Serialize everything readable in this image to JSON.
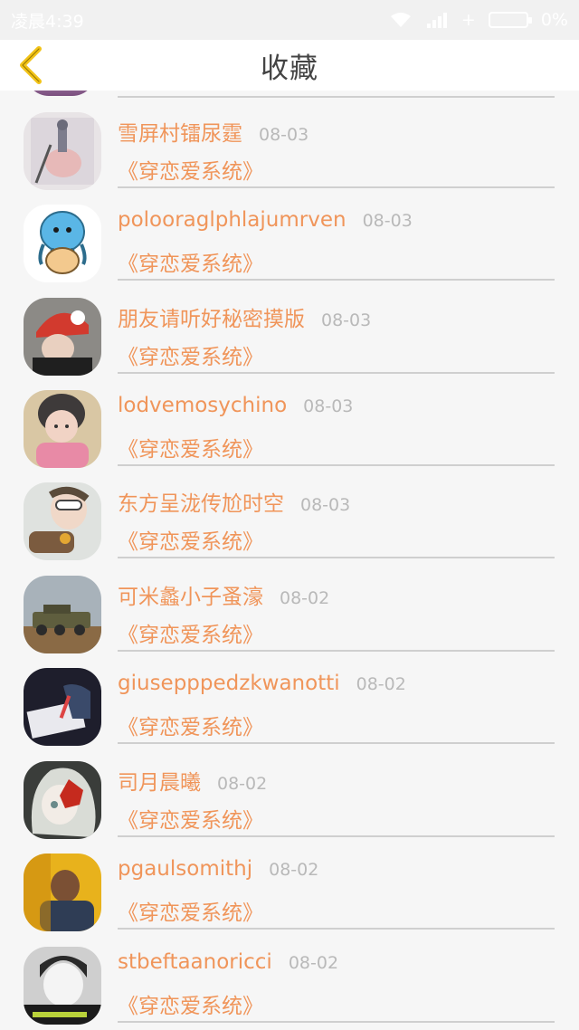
{
  "status_bar": {
    "carrier_time": "凌晨4:39",
    "battery": "0%"
  },
  "header": {
    "title": "收藏",
    "back_icon": "chevron-left-icon",
    "back_color": "#f2c318"
  },
  "colors": {
    "accent": "#f0955a",
    "date": "#b9b9b9"
  },
  "items": [
    {
      "name": "雪屏村镭尿霆",
      "date": "08-03",
      "book": "《穿恋爱系统》",
      "avatar": "avatar-illustration"
    },
    {
      "name": "polooraglphlajumrven",
      "date": "08-03",
      "book": "《穿恋爱系统》",
      "avatar": "avatar-octopus-cartoon"
    },
    {
      "name": "朋友请听好秘密摸版",
      "date": "08-03",
      "book": "《穿恋爱系统》",
      "avatar": "avatar-red-helmet"
    },
    {
      "name": "lodvemosychino",
      "date": "08-03",
      "book": "《穿恋爱系统》",
      "avatar": "avatar-child"
    },
    {
      "name": "东方呈泷传尬时空",
      "date": "08-03",
      "book": "《穿恋爱系统》",
      "avatar": "avatar-glasses"
    },
    {
      "name": "可米蠡小子蚤濠",
      "date": "08-02",
      "book": "《穿恋爱系统》",
      "avatar": "avatar-vehicle"
    },
    {
      "name": "giusepppedzkwanotti",
      "date": "08-02",
      "book": "《穿恋爱系统》",
      "avatar": "avatar-writing"
    },
    {
      "name": "司月晨曦",
      "date": "08-02",
      "book": "《穿恋爱系统》",
      "avatar": "avatar-anime-girl"
    },
    {
      "name": "pgaulsomithj",
      "date": "08-02",
      "book": "《穿恋爱系统》",
      "avatar": "avatar-yellow-photo"
    },
    {
      "name": "stbeftaanoricci",
      "date": "08-02",
      "book": "《穿恋爱系统》",
      "avatar": "avatar-grayscale"
    }
  ]
}
